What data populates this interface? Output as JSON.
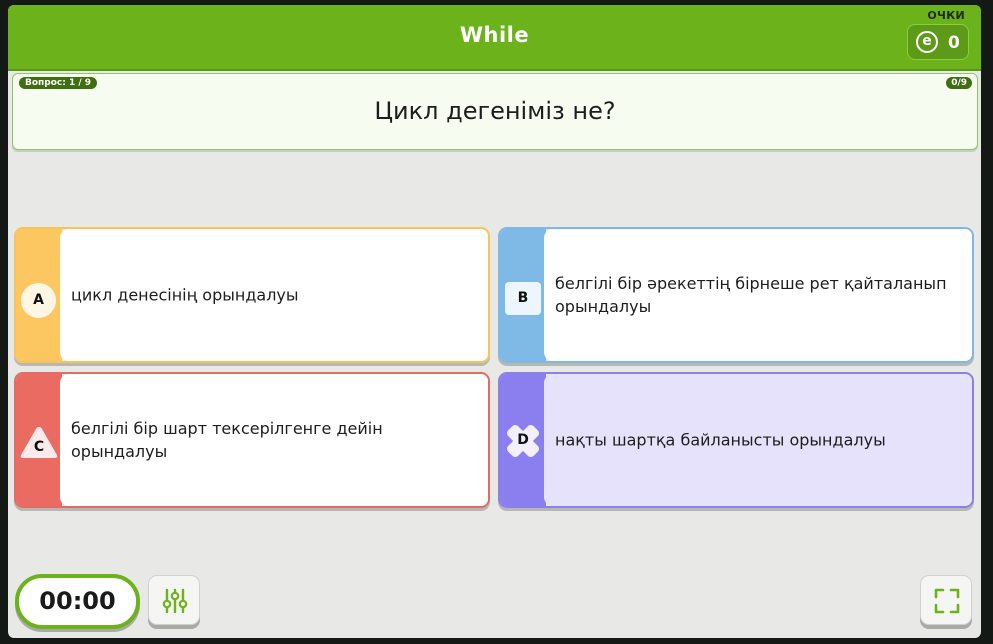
{
  "header": {
    "title": "While",
    "points_label": "ОЧКИ",
    "points_value": "0",
    "coin_symbol": "e"
  },
  "question": {
    "number_label": "Вопрос: 1 / 9",
    "progress_label": "0/9",
    "text": "Цикл дегеніміз не?"
  },
  "answers": [
    {
      "letter": "A",
      "shape": "circle",
      "text": "цикл денесінің орындалуы",
      "color": "#fcc760"
    },
    {
      "letter": "B",
      "shape": "square",
      "text": "белгілі бір әрекеттің бірнеше рет қайталанып орындалуы",
      "color": "#7fb9e6"
    },
    {
      "letter": "C",
      "shape": "triangle",
      "text": "белгілі бір шарт тексерілгенге дейін орындалуы",
      "color": "#ea6b62"
    },
    {
      "letter": "D",
      "shape": "cross",
      "text": "нақты шартқа байланысты орындалуы",
      "color": "#8b7ff0"
    }
  ],
  "footer": {
    "timer": "00:00",
    "settings_icon": "sliders-icon",
    "fullscreen_icon": "fullscreen-icon"
  },
  "theme": {
    "accent": "#6cb21a",
    "background": "#e8e8e6"
  }
}
